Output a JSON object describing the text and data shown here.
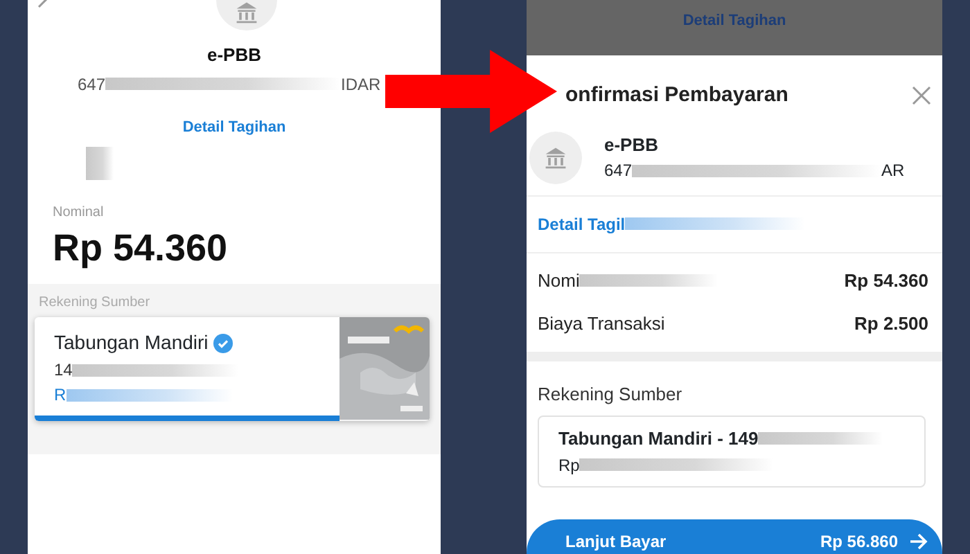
{
  "left_screen": {
    "biller": {
      "name": "e-PBB",
      "number_start": "647",
      "number_end": "IDAR"
    },
    "detail_link": "Detail Tagihan",
    "nominal_label": "Nominal",
    "nominal_value": "Rp 54.360",
    "source_label": "Rekening Sumber",
    "account": {
      "name": "Tabungan Mandiri",
      "verified": true,
      "number_start": "14",
      "balance_start": "R"
    }
  },
  "right_screen": {
    "backdrop_link": "Detail Tagihan",
    "title": "onfirmasi Pembayaran",
    "biller": {
      "name": "e-PBB",
      "number_start": "647",
      "number_end": "AR"
    },
    "detail_link": "Detail Tagil",
    "rows": [
      {
        "label": "Nomi",
        "value": "Rp 54.360",
        "blurred": true
      },
      {
        "label": "Biaya Transaksi",
        "value": "Rp 2.500",
        "blurred": false
      }
    ],
    "source_label": "Rekening Sumber",
    "account": {
      "name": "Tabungan Mandiri - 149",
      "balance_start": "Rp"
    },
    "button": {
      "label": "Lanjut Bayar",
      "amount": "Rp 56.860"
    }
  }
}
